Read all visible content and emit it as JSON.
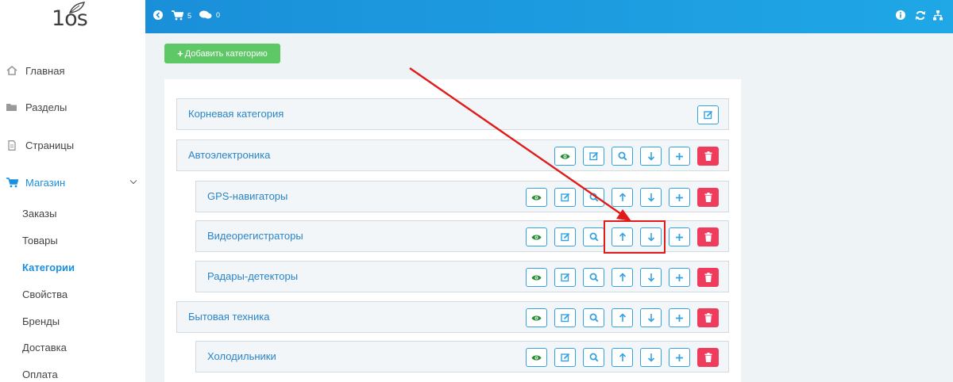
{
  "logo": {
    "text": "1os"
  },
  "topbar": {
    "cart_count": "5",
    "chat_count": "0"
  },
  "sidebar": {
    "items": [
      {
        "label": "Главная",
        "icon": "home-icon"
      },
      {
        "label": "Разделы",
        "icon": "folder-icon"
      },
      {
        "label": "Страницы",
        "icon": "page-icon"
      },
      {
        "label": "Магазин",
        "icon": "cart-icon"
      }
    ],
    "sub_items": [
      "Заказы",
      "Товары",
      "Категории",
      "Свойства",
      "Бренды",
      "Доставка",
      "Оплата"
    ]
  },
  "add_button": {
    "label": "Добавить категорию"
  },
  "categories": [
    {
      "label": "Корневая категория"
    },
    {
      "label": "Автоэлектроника"
    },
    {
      "label": "GPS-навигаторы"
    },
    {
      "label": "Видеорегистраторы"
    },
    {
      "label": "Радары-детекторы"
    },
    {
      "label": "Бытовая техника"
    },
    {
      "label": "Холодильники"
    }
  ],
  "colors": {
    "accent": "#1a8fe0",
    "topbar": "#1a9ae0",
    "add": "#5fc866",
    "delete": "#f03c5c",
    "eye": "#1f8a2e",
    "annotation": "#e11a1a"
  }
}
